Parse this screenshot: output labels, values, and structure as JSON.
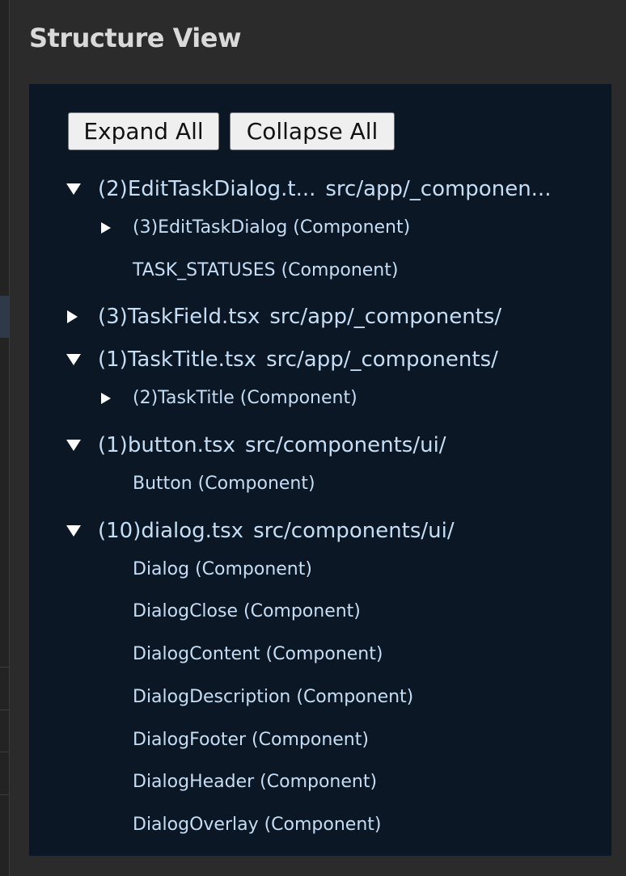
{
  "panel": {
    "title": "Structure View"
  },
  "toolbar": {
    "expand_all": "Expand All",
    "collapse_all": "Collapse All"
  },
  "tree": {
    "files": [
      {
        "name": "(2)EditTaskDialog.t...",
        "path": "src/app/_componen...",
        "expanded": true,
        "children": [
          {
            "label": "(3)EditTaskDialog (Component)",
            "expandable": true
          },
          {
            "label": "TASK_STATUSES (Component)",
            "expandable": false
          }
        ]
      },
      {
        "name": "(3)TaskField.tsx",
        "path": "src/app/_components/",
        "expanded": false,
        "children": []
      },
      {
        "name": "(1)TaskTitle.tsx",
        "path": "src/app/_components/",
        "expanded": true,
        "children": [
          {
            "label": "(2)TaskTitle (Component)",
            "expandable": true
          }
        ]
      },
      {
        "name": "(1)button.tsx",
        "path": "src/components/ui/",
        "expanded": true,
        "children": [
          {
            "label": "Button (Component)",
            "expandable": false
          }
        ]
      },
      {
        "name": "(10)dialog.tsx",
        "path": "src/components/ui/",
        "expanded": true,
        "children": [
          {
            "label": "Dialog (Component)",
            "expandable": false
          },
          {
            "label": "DialogClose (Component)",
            "expandable": false
          },
          {
            "label": "DialogContent (Component)",
            "expandable": false
          },
          {
            "label": "DialogDescription (Component)",
            "expandable": false
          },
          {
            "label": "DialogFooter (Component)",
            "expandable": false
          },
          {
            "label": "DialogHeader (Component)",
            "expandable": false
          },
          {
            "label": "DialogOverlay (Component)",
            "expandable": false
          }
        ]
      }
    ]
  },
  "colors": {
    "panel_bg": "#2b2b2b",
    "tree_bg": "#0c1726",
    "tree_text": "#c5def5",
    "title_text": "#d9d9d9",
    "button_bg": "#efefef"
  },
  "icons": {
    "expanded": "triangle-down-icon",
    "collapsed": "triangle-right-icon"
  }
}
